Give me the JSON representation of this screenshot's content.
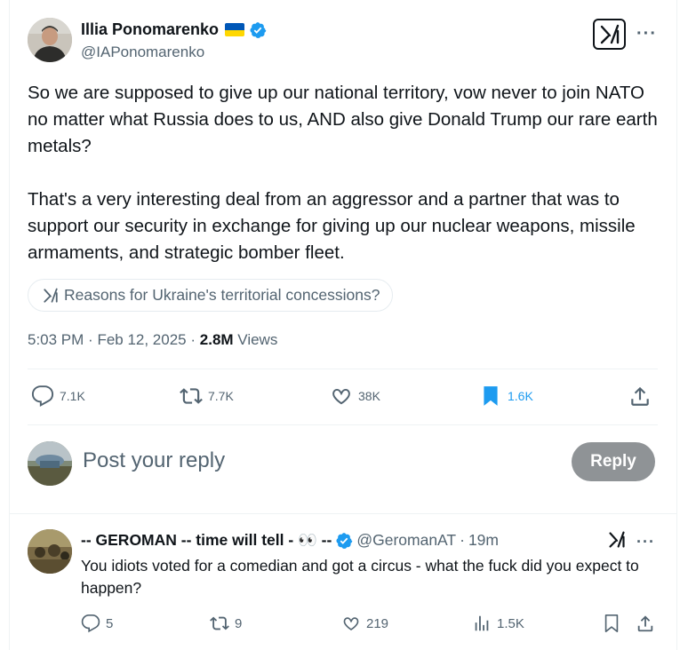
{
  "tweet": {
    "author_name": "Illia Ponomarenko",
    "author_handle": "@IAPonomarenko",
    "paragraph_1": "So we are supposed to give up our national territory, vow never to join NATO no matter what Russia does to us, AND also give Donald Trump our rare earth metals?",
    "paragraph_2": "That's a very interesting deal from an aggressor and a partner that was to support our security in exchange for giving up our nuclear weapons, missile armaments, and strategic bomber fleet.",
    "grok_prompt": "Reasons for Ukraine's territorial concessions?",
    "time": "5:03 PM",
    "date": "Feb 12, 2025",
    "views_count": "2.8M",
    "views_label": "Views",
    "more_icon": "···",
    "stats": {
      "replies": "7.1K",
      "reposts": "7.7K",
      "likes": "38K",
      "bookmarks": "1.6K"
    },
    "accent_color": "#1d9bf0"
  },
  "reply_box": {
    "placeholder": "Post your reply",
    "button_label": "Reply"
  },
  "comment": {
    "author_name": "-- GEROMAN -- time will tell - 👀 --",
    "author_handle": "@GeromanAT",
    "separator": "·",
    "time_ago": "19m",
    "more_icon": "···",
    "text": "You idiots voted for a comedian and got a circus - what the fuck did you expect to happen?",
    "stats": {
      "replies": "5",
      "reposts": "9",
      "likes": "219",
      "views": "1.5K"
    }
  }
}
